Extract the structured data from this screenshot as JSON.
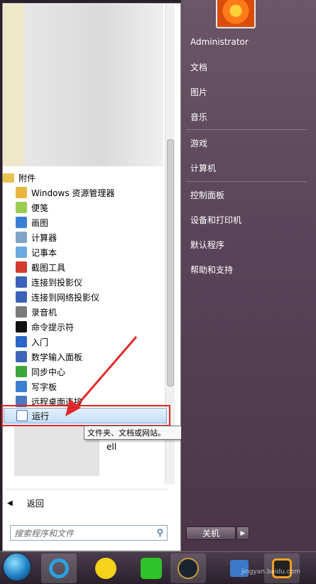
{
  "left_pane": {
    "accessories_folder": "附件",
    "programs": [
      {
        "name": "windows-explorer",
        "label": "Windows 资源管理器",
        "color": "#e8b640"
      },
      {
        "name": "sticky-notes",
        "label": "便笺",
        "color": "#9ccc52"
      },
      {
        "name": "paint",
        "label": "画图",
        "color": "#3a7fd0"
      },
      {
        "name": "calculator",
        "label": "计算器",
        "color": "#7fa4c8"
      },
      {
        "name": "notepad",
        "label": "记事本",
        "color": "#6aa9e0"
      },
      {
        "name": "snipping-tool",
        "label": "截图工具",
        "color": "#d33b2e"
      },
      {
        "name": "connect-projector",
        "label": "连接到投影仪",
        "color": "#3a62b8"
      },
      {
        "name": "connect-network-projector",
        "label": "连接到网络投影仪",
        "color": "#3a62b8"
      },
      {
        "name": "sound-recorder",
        "label": "录音机",
        "color": "#7a7a7a"
      },
      {
        "name": "command-prompt",
        "label": "命令提示符",
        "color": "#111111"
      },
      {
        "name": "getting-started",
        "label": "入门",
        "color": "#2b66c7"
      },
      {
        "name": "math-input-panel",
        "label": "数学输入面板",
        "color": "#3d66b8"
      },
      {
        "name": "sync-center",
        "label": "同步中心",
        "color": "#3da63b"
      },
      {
        "name": "wordpad",
        "label": "写字板",
        "color": "#3a7fd0"
      },
      {
        "name": "remote-desktop",
        "label": "远程桌面连接",
        "color": "#4a78c0"
      }
    ],
    "run_label": "运行",
    "tooltip": "文件夹、文档或网站。",
    "partial_label": "ell",
    "back_label": "返回",
    "search_placeholder": "搜索程序和文件"
  },
  "right_pane": {
    "items_group1": [
      "Administrator",
      "文档",
      "图片",
      "音乐"
    ],
    "items_group2": [
      "游戏",
      "计算机"
    ],
    "items_group3": [
      "控制面板",
      "设备和打印机",
      "默认程序",
      "帮助和支持"
    ],
    "shutdown_label": "关机"
  },
  "watermark": "jingyan.baidu.com"
}
